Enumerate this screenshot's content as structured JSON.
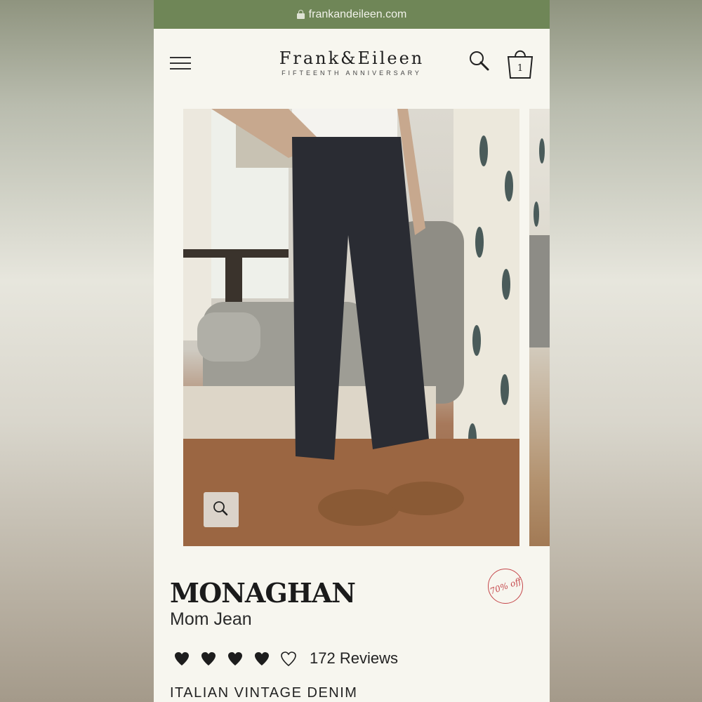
{
  "browser": {
    "url": "frankandeileen.com"
  },
  "header": {
    "brand_name": "Frank&Eileen",
    "brand_tagline": "FIFTEENTH ANNIVERSARY",
    "cart_count": "1"
  },
  "product": {
    "name": "MONAGHAN",
    "style": "Mom Jean",
    "discount_badge": "70% off",
    "rating": 4.5,
    "rating_max": 5,
    "reviews_label": "172 Reviews",
    "collection": "ITALIAN VINTAGE DENIM"
  },
  "colors": {
    "url_bar": "#6f8657",
    "page_background": "#f7f6ef",
    "badge_red": "#c5474b"
  },
  "icons": [
    "lock-icon",
    "menu-icon",
    "search-icon",
    "shopping-bag-icon",
    "zoom-icon",
    "heart-icon"
  ]
}
